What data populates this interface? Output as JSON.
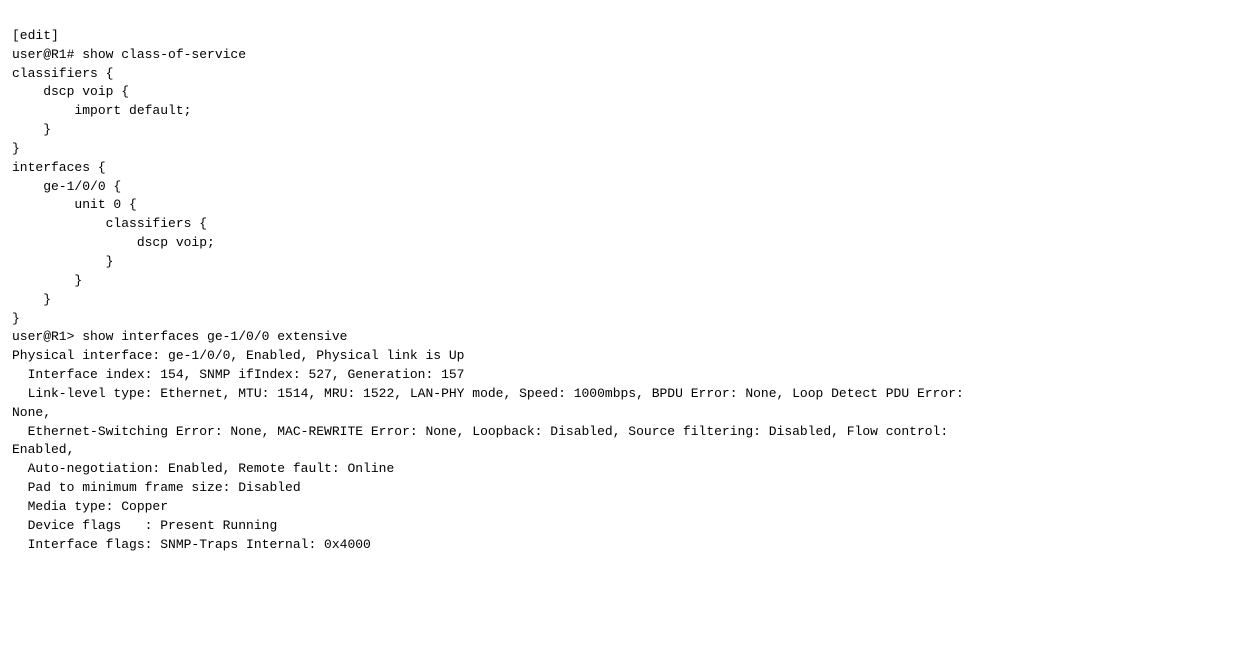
{
  "terminal": {
    "lines": [
      "[edit]",
      "user@R1# show class-of-service",
      "classifiers {",
      "    dscp voip {",
      "        import default;",
      "    }",
      "}",
      "interfaces {",
      "    ge-1/0/0 {",
      "        unit 0 {",
      "            classifiers {",
      "                dscp voip;",
      "            }",
      "        }",
      "    }",
      "}",
      "user@R1> show interfaces ge-1/0/0 extensive",
      "Physical interface: ge-1/0/0, Enabled, Physical link is Up",
      "  Interface index: 154, SNMP ifIndex: 527, Generation: 157",
      "  Link-level type: Ethernet, MTU: 1514, MRU: 1522, LAN-PHY mode, Speed: 1000mbps, BPDU Error: None, Loop Detect PDU Error:",
      "None,",
      "  Ethernet-Switching Error: None, MAC-REWRITE Error: None, Loopback: Disabled, Source filtering: Disabled, Flow control:",
      "Enabled,",
      "  Auto-negotiation: Enabled, Remote fault: Online",
      "  Pad to minimum frame size: Disabled",
      "  Media type: Copper",
      "  Device flags   : Present Running",
      "  Interface flags: SNMP-Traps Internal: 0x4000"
    ]
  }
}
